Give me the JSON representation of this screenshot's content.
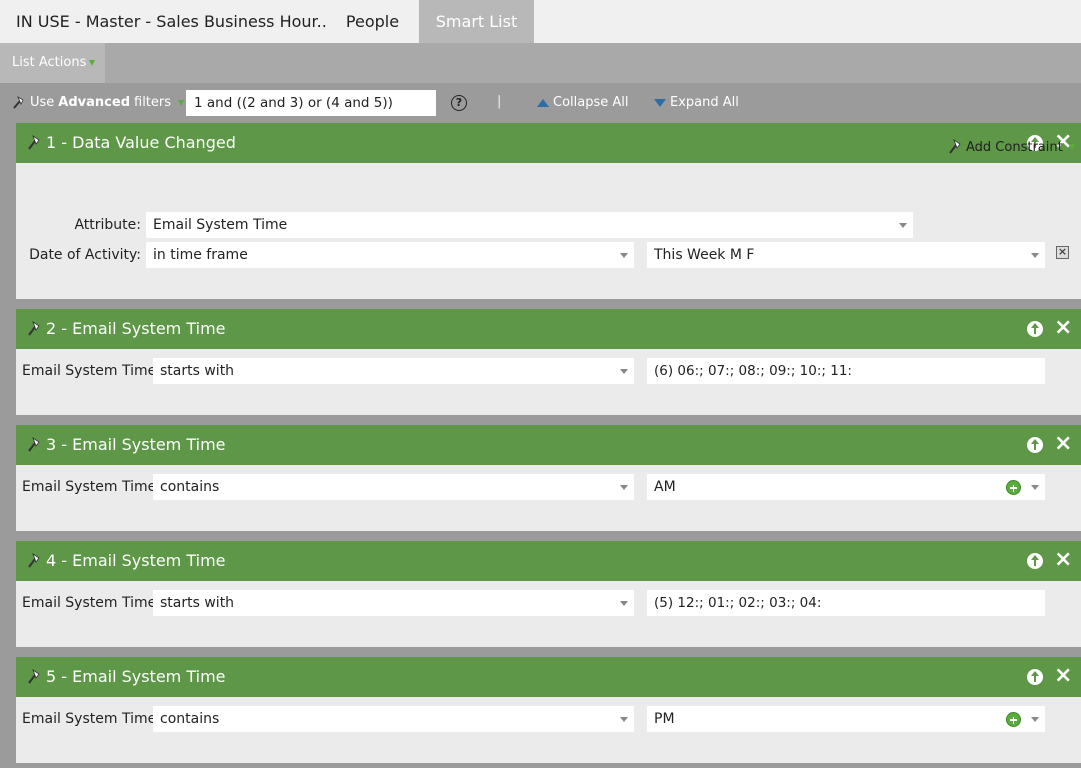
{
  "tabs": [
    {
      "label": "IN USE - Master - Sales Business Hour..."
    },
    {
      "label": "People"
    },
    {
      "label": "Smart List"
    }
  ],
  "list_actions": {
    "label": "List Actions"
  },
  "toolbar": {
    "use_label": "Use",
    "advanced_label": "Advanced",
    "filters_label": "filters",
    "logic_value": "1 and ((2 and 3) or (4 and 5))",
    "help": "?",
    "separator": "|",
    "collapse_label": "Collapse All",
    "expand_label": "Expand All"
  },
  "filters": [
    {
      "title": "1 - Data Value Changed",
      "add_constraint_label": "Add Constraint",
      "attribute_label": "Attribute:",
      "attribute_value": "Email System Time",
      "date_label": "Date of Activity:",
      "date_operator": "in time frame",
      "date_value": "This Week M F"
    },
    {
      "title": "2 - Email System Time",
      "field_label": "Email System Time:",
      "operator": "starts with",
      "value": "(6) 06:; 07:; 08:; 09:; 10:; 11:"
    },
    {
      "title": "3 - Email System Time",
      "field_label": "Email System Time:",
      "operator": "contains",
      "value": "AM"
    },
    {
      "title": "4 - Email System Time",
      "field_label": "Email System Time:",
      "operator": "starts with",
      "value": "(5) 12:; 01:; 02:; 03:; 04:"
    },
    {
      "title": "5 - Email System Time",
      "field_label": "Email System Time:",
      "operator": "contains",
      "value": "PM"
    }
  ],
  "colors": {
    "header_green": "#5e9747",
    "page_gray": "#9b9b9b",
    "card_bg": "#ebebeb",
    "active_tab": "#b8b8b8"
  }
}
